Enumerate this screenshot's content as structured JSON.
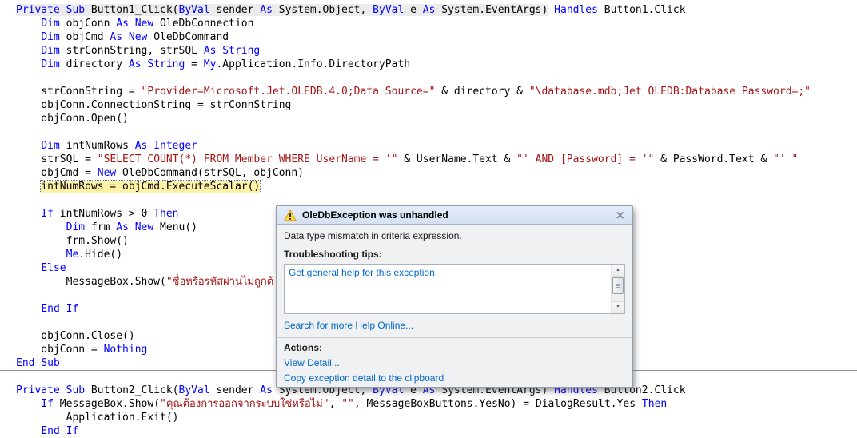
{
  "editor": {
    "colors": {
      "keyword": "#0000ff",
      "string": "#a31515",
      "highlight_bg": "#fdf2a5",
      "highlight_border": "#4f75a3",
      "header_bg": "#ececec"
    },
    "lines": [
      {
        "t": [
          [
            "Private",
            "k g"
          ],
          [
            " ",
            "p g"
          ],
          [
            "Sub",
            "k g"
          ],
          [
            " Button1_Click(",
            "p g"
          ],
          [
            "ByVal",
            "k g"
          ],
          [
            " sender ",
            "p g"
          ],
          [
            "As",
            "k g"
          ],
          [
            " System.Object, ",
            "p g"
          ],
          [
            "ByVal",
            "k g"
          ],
          [
            " e ",
            "p g"
          ],
          [
            "As",
            "k g"
          ],
          [
            " System.EventArgs)",
            "p g"
          ],
          [
            " ",
            "p"
          ],
          [
            "Handles",
            "k"
          ],
          [
            " Button1.Click",
            "p"
          ]
        ]
      },
      {
        "t": [
          [
            "    ",
            "p"
          ],
          [
            "Dim",
            "k"
          ],
          [
            " objConn ",
            "p"
          ],
          [
            "As",
            "k"
          ],
          [
            " ",
            "p"
          ],
          [
            "New",
            "k"
          ],
          [
            " OleDbConnection",
            "p"
          ]
        ]
      },
      {
        "t": [
          [
            "    ",
            "p"
          ],
          [
            "Dim",
            "k"
          ],
          [
            " objCmd ",
            "p"
          ],
          [
            "As",
            "k"
          ],
          [
            " ",
            "p"
          ],
          [
            "New",
            "k"
          ],
          [
            " OleDbCommand",
            "p"
          ]
        ]
      },
      {
        "t": [
          [
            "    ",
            "p"
          ],
          [
            "Dim",
            "k"
          ],
          [
            " strConnString, strSQL ",
            "p"
          ],
          [
            "As",
            "k"
          ],
          [
            " ",
            "p"
          ],
          [
            "String",
            "k"
          ]
        ]
      },
      {
        "t": [
          [
            "    ",
            "p"
          ],
          [
            "Dim",
            "k"
          ],
          [
            " directory ",
            "p"
          ],
          [
            "As",
            "k"
          ],
          [
            " ",
            "p"
          ],
          [
            "String",
            "k"
          ],
          [
            " = ",
            "p"
          ],
          [
            "My",
            "k"
          ],
          [
            ".Application.Info.DirectoryPath",
            "p"
          ]
        ]
      },
      {
        "t": []
      },
      {
        "t": [
          [
            "    strConnString = ",
            "p"
          ],
          [
            "\"Provider=Microsoft.Jet.OLEDB.4.0;Data Source=\"",
            "s"
          ],
          [
            " & directory & ",
            "p"
          ],
          [
            "\"\\database.mdb;Jet OLEDB:Database Password=;\"",
            "s"
          ]
        ]
      },
      {
        "t": [
          [
            "    objConn.ConnectionString = strConnString",
            "p"
          ]
        ]
      },
      {
        "t": [
          [
            "    objConn.Open()",
            "p"
          ]
        ]
      },
      {
        "t": []
      },
      {
        "t": [
          [
            "    ",
            "p"
          ],
          [
            "Dim",
            "k"
          ],
          [
            " intNumRows ",
            "p"
          ],
          [
            "As",
            "k"
          ],
          [
            " ",
            "p"
          ],
          [
            "Integer",
            "k"
          ]
        ]
      },
      {
        "t": [
          [
            "    strSQL = ",
            "p"
          ],
          [
            "\"SELECT COUNT(*) FROM Member WHERE UserName = '\"",
            "s"
          ],
          [
            " & UserName.Text & ",
            "p"
          ],
          [
            "\"' AND [Password] = '\"",
            "s"
          ],
          [
            " & PassWord.Text & ",
            "p"
          ],
          [
            "\"' \"",
            "s"
          ]
        ]
      },
      {
        "t": [
          [
            "    objCmd = ",
            "p"
          ],
          [
            "New",
            "k"
          ],
          [
            " OleDbCommand(strSQL, objConn)",
            "p"
          ]
        ]
      },
      {
        "ind": "    ",
        "hl": true,
        "t": [
          [
            "intNumRows = objCmd.ExecuteScalar()",
            "p"
          ]
        ]
      },
      {
        "t": []
      },
      {
        "t": [
          [
            "    ",
            "p"
          ],
          [
            "If",
            "k"
          ],
          [
            " intNumRows > 0 ",
            "p"
          ],
          [
            "Then",
            "k"
          ]
        ]
      },
      {
        "t": [
          [
            "        ",
            "p"
          ],
          [
            "Dim",
            "k"
          ],
          [
            " frm ",
            "p"
          ],
          [
            "As",
            "k"
          ],
          [
            " ",
            "p"
          ],
          [
            "New",
            "k"
          ],
          [
            " Menu()",
            "p"
          ]
        ]
      },
      {
        "t": [
          [
            "        frm.Show()",
            "p"
          ]
        ]
      },
      {
        "t": [
          [
            "        ",
            "p"
          ],
          [
            "Me",
            "k"
          ],
          [
            ".Hide()",
            "p"
          ]
        ]
      },
      {
        "t": [
          [
            "    ",
            "p"
          ],
          [
            "Else",
            "k"
          ]
        ]
      },
      {
        "t": [
          [
            "        MessageBox.Show(",
            "p"
          ],
          [
            "\"ชื่อหรือรหัสผ่านไม่ถูกต้",
            "s"
          ]
        ]
      },
      {
        "t": []
      },
      {
        "t": [
          [
            "    ",
            "p"
          ],
          [
            "End If",
            "k"
          ]
        ]
      },
      {
        "t": []
      },
      {
        "t": [
          [
            "    objConn.Close()",
            "p"
          ]
        ]
      },
      {
        "t": [
          [
            "    objConn = ",
            "p"
          ],
          [
            "Nothing",
            "k"
          ]
        ]
      },
      {
        "t": [
          [
            "End",
            "k"
          ],
          [
            " ",
            "p"
          ],
          [
            "Sub",
            "k"
          ]
        ]
      },
      {
        "t": []
      },
      {
        "t": [
          [
            "Private",
            "k"
          ],
          [
            " ",
            "p"
          ],
          [
            "Sub",
            "k"
          ],
          [
            " Button2_Click(",
            "p"
          ],
          [
            "ByVal",
            "k"
          ],
          [
            " sender ",
            "p"
          ],
          [
            "As",
            "k"
          ],
          [
            " System.Object, ",
            "p"
          ],
          [
            "ByVal",
            "k"
          ],
          [
            " e ",
            "p"
          ],
          [
            "As",
            "k"
          ],
          [
            " System.EventArgs) ",
            "p"
          ],
          [
            "Handles",
            "k"
          ],
          [
            " Button2.Click",
            "p"
          ]
        ]
      },
      {
        "t": [
          [
            "    ",
            "p"
          ],
          [
            "If",
            "k"
          ],
          [
            " MessageBox.Show(",
            "p"
          ],
          [
            "\"คุณต้องการออกจากระบบใช่หรือไม่\"",
            "s"
          ],
          [
            ", ",
            "p"
          ],
          [
            "\"\"",
            "s"
          ],
          [
            ", MessageBoxButtons.YesNo) = DialogResult.Yes ",
            "p"
          ],
          [
            "Then",
            "k"
          ]
        ]
      },
      {
        "t": [
          [
            "        Application.Exit()",
            "p"
          ]
        ]
      },
      {
        "t": [
          [
            "    ",
            "p"
          ],
          [
            "End If",
            "k"
          ]
        ]
      }
    ]
  },
  "dialog": {
    "title": "OleDbException was unhandled",
    "close_glyph": "×",
    "message": "Data type mismatch in criteria expression.",
    "tips_label": "Troubleshooting tips:",
    "tips": [
      "Get general help for this exception."
    ],
    "search_link": "Search for more Help Online...",
    "actions_label": "Actions:",
    "actions": [
      "View Detail...",
      "Copy exception detail to the clipboard"
    ],
    "scrollbar": {
      "up_glyph": "▲",
      "down_glyph": "▼"
    },
    "link_color": "#0066cc",
    "warning_color": "#ffd83d",
    "warning_border": "#d9a00f"
  }
}
